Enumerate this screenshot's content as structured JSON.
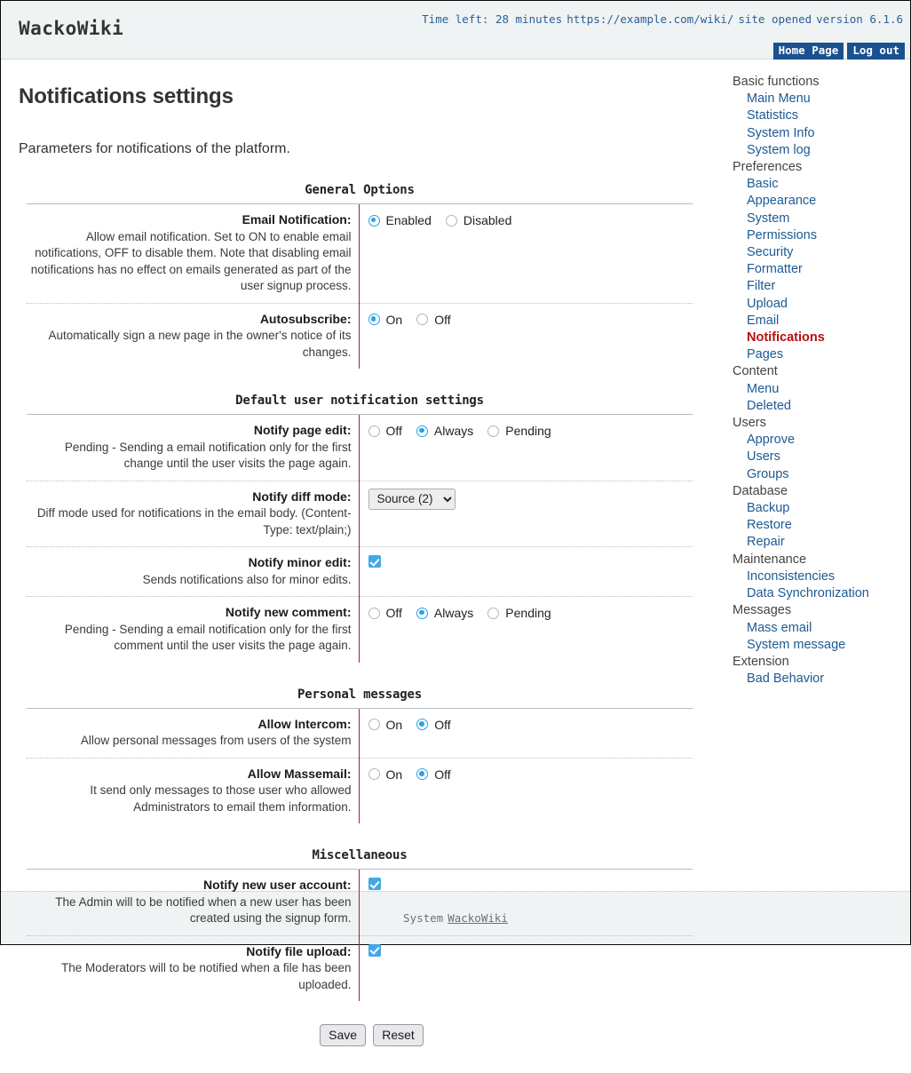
{
  "header": {
    "site_title": "WackoWiki",
    "time_left": "Time left: 28 minutes",
    "site_url": "https://example.com/wiki/",
    "site_status": "site opened",
    "version": "version 6.1.6",
    "home_button": "Home Page",
    "logout_button": "Log out",
    "accent_button_color": "#1a5190",
    "info_text_color": "#2b6094"
  },
  "main": {
    "page_title": "Notifications settings",
    "intro": "Parameters for notifications of the platform.",
    "save_label": "Save",
    "reset_label": "Reset"
  },
  "sections": [
    {
      "title": "General Options",
      "rows": [
        {
          "label": "Email Notification:",
          "desc": "Allow email notification. Set to ON to enable email notifications, OFF to disable them. Note that disabling email notifications has no effect on emails generated as part of the user signup process.",
          "control": "radio",
          "options": [
            "Enabled",
            "Disabled"
          ],
          "selected": "Enabled"
        },
        {
          "label": "Autosubscribe:",
          "desc": "Automatically sign a new page in the owner's notice of its changes.",
          "control": "radio",
          "options": [
            "On",
            "Off"
          ],
          "selected": "On"
        }
      ]
    },
    {
      "title": "Default user notification settings",
      "rows": [
        {
          "label": "Notify page edit:",
          "desc": "Pending - Sending a email notification only for the first change until the user visits the page again.",
          "control": "radio",
          "options": [
            "Off",
            "Always",
            "Pending"
          ],
          "selected": "Always"
        },
        {
          "label": "Notify diff mode:",
          "desc": "Diff mode used for notifications in the email body. (Content-Type: text/plain;)",
          "control": "select",
          "options": [
            "Source (2)"
          ],
          "selected": "Source (2)"
        },
        {
          "label": "Notify minor edit:",
          "desc": "Sends notifications also for minor edits.",
          "control": "checkbox",
          "checked": true
        },
        {
          "label": "Notify new comment:",
          "desc": "Pending - Sending a email notification only for the first comment until the user visits the page again.",
          "control": "radio",
          "options": [
            "Off",
            "Always",
            "Pending"
          ],
          "selected": "Always"
        }
      ]
    },
    {
      "title": "Personal messages",
      "rows": [
        {
          "label": "Allow Intercom:",
          "desc": "Allow personal messages from users of the system",
          "control": "radio",
          "options": [
            "On",
            "Off"
          ],
          "selected": "Off"
        },
        {
          "label": "Allow Massemail:",
          "desc": "It send only messages to those user who allowed Administrators to email them information.",
          "control": "radio",
          "options": [
            "On",
            "Off"
          ],
          "selected": "Off"
        }
      ]
    },
    {
      "title": "Miscellaneous",
      "rows": [
        {
          "label": "Notify new user account:",
          "desc": "The Admin will to be notified when a new user has been created using the signup form.",
          "control": "checkbox",
          "checked": true
        },
        {
          "label": "Notify file upload:",
          "desc": "The Moderators will to be notified when a file has been uploaded.",
          "control": "checkbox",
          "checked": true
        }
      ]
    }
  ],
  "sidebar": {
    "active_color": "#b8100f",
    "link_color": "#1c5a94",
    "entries": [
      {
        "type": "group",
        "label": "Basic functions"
      },
      {
        "type": "item",
        "label": "Main Menu"
      },
      {
        "type": "item",
        "label": "Statistics"
      },
      {
        "type": "item",
        "label": "System Info"
      },
      {
        "type": "item",
        "label": "System log"
      },
      {
        "type": "group",
        "label": "Preferences"
      },
      {
        "type": "item",
        "label": "Basic"
      },
      {
        "type": "item",
        "label": "Appearance"
      },
      {
        "type": "item",
        "label": "System"
      },
      {
        "type": "item",
        "label": "Permissions"
      },
      {
        "type": "item",
        "label": "Security"
      },
      {
        "type": "item",
        "label": "Formatter"
      },
      {
        "type": "item",
        "label": "Filter"
      },
      {
        "type": "item",
        "label": "Upload"
      },
      {
        "type": "item",
        "label": "Email"
      },
      {
        "type": "item",
        "label": "Notifications",
        "active": true
      },
      {
        "type": "item",
        "label": "Pages"
      },
      {
        "type": "group",
        "label": "Content"
      },
      {
        "type": "item",
        "label": "Menu"
      },
      {
        "type": "item",
        "label": "Deleted"
      },
      {
        "type": "group",
        "label": "Users"
      },
      {
        "type": "item",
        "label": "Approve"
      },
      {
        "type": "item",
        "label": "Users"
      },
      {
        "type": "item",
        "label": "Groups"
      },
      {
        "type": "group",
        "label": "Database"
      },
      {
        "type": "item",
        "label": "Backup"
      },
      {
        "type": "item",
        "label": "Restore"
      },
      {
        "type": "item",
        "label": "Repair"
      },
      {
        "type": "group",
        "label": "Maintenance"
      },
      {
        "type": "item",
        "label": "Inconsistencies"
      },
      {
        "type": "item",
        "label": "Data Synchronization"
      },
      {
        "type": "group",
        "label": "Messages"
      },
      {
        "type": "item",
        "label": "Mass email"
      },
      {
        "type": "item",
        "label": "System message"
      },
      {
        "type": "group",
        "label": "Extension"
      },
      {
        "type": "item",
        "label": "Bad Behavior"
      }
    ]
  },
  "footer": {
    "prefix": "System",
    "link": "WackoWiki"
  }
}
